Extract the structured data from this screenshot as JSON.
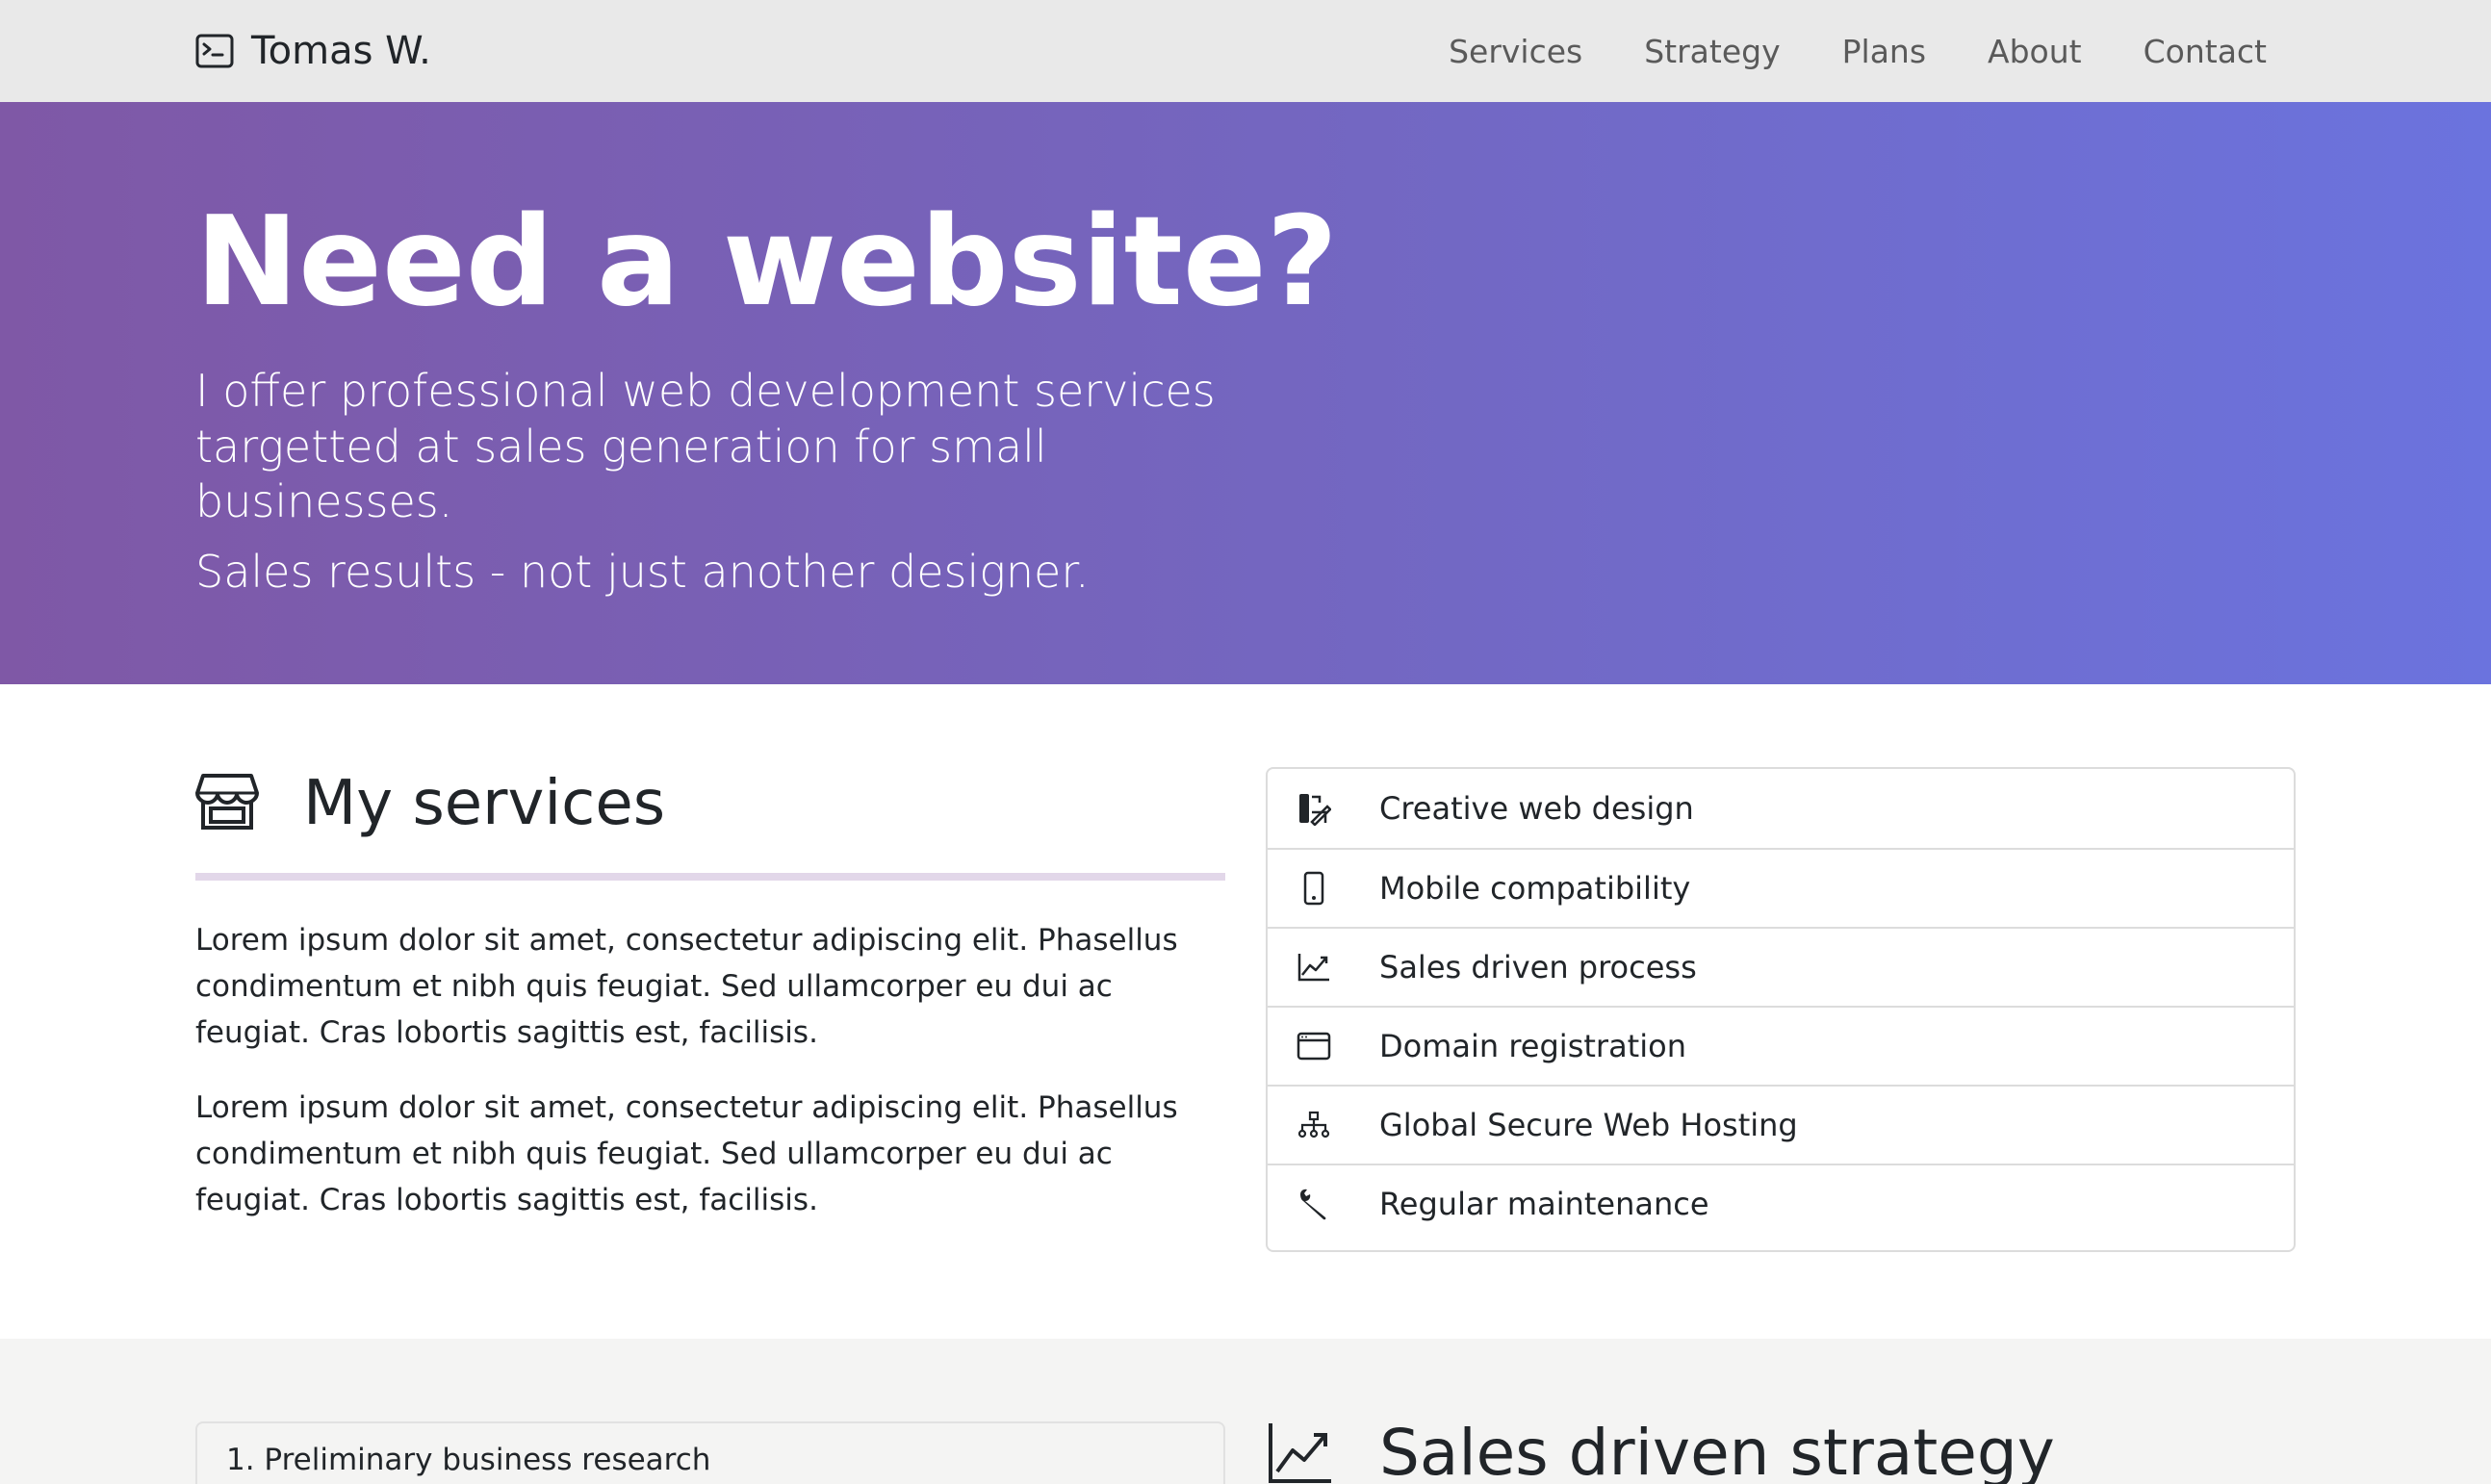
{
  "brand": {
    "name": "Tomas W.",
    "icon": "terminal-icon"
  },
  "nav": [
    "Services",
    "Strategy",
    "Plans",
    "About",
    "Contact"
  ],
  "hero": {
    "title": "Need a website?",
    "lead": "I offer professional web development services targetted at sales generation for small businesses.",
    "tagline": "Sales results - not just another designer."
  },
  "services": {
    "icon": "shop-icon",
    "title": "My services",
    "paragraphs": [
      "Lorem ipsum dolor sit amet, consectetur adipiscing elit. Phasellus condimentum et nibh quis feugiat. Sed ullamcorper eu dui ac feugiat. Cras lobortis sagittis est, facilisis.",
      "Lorem ipsum dolor sit amet, consectetur adipiscing elit. Phasellus condimentum et nibh quis feugiat. Sed ullamcorper eu dui ac feugiat. Cras lobortis sagittis est, facilisis."
    ],
    "items": [
      {
        "label": "Creative web design",
        "icon": "brush-icon"
      },
      {
        "label": "Mobile compatibility",
        "icon": "phone-icon"
      },
      {
        "label": "Sales driven process",
        "icon": "graph-up-icon"
      },
      {
        "label": "Domain registration",
        "icon": "browser-window-icon"
      },
      {
        "label": "Global Secure Web Hosting",
        "icon": "diagram-icon"
      },
      {
        "label": "Regular maintenance",
        "icon": "wrench-icon"
      }
    ]
  },
  "strategy": {
    "step1": "1. Preliminary business research",
    "title": "Sales driven strategy",
    "icon": "graph-up-icon"
  },
  "colors": {
    "navbar_bg": "#e9e9e9",
    "hero_start": "#7f58a6",
    "hero_end": "#6b73de",
    "rule": "#e2d7e9"
  }
}
